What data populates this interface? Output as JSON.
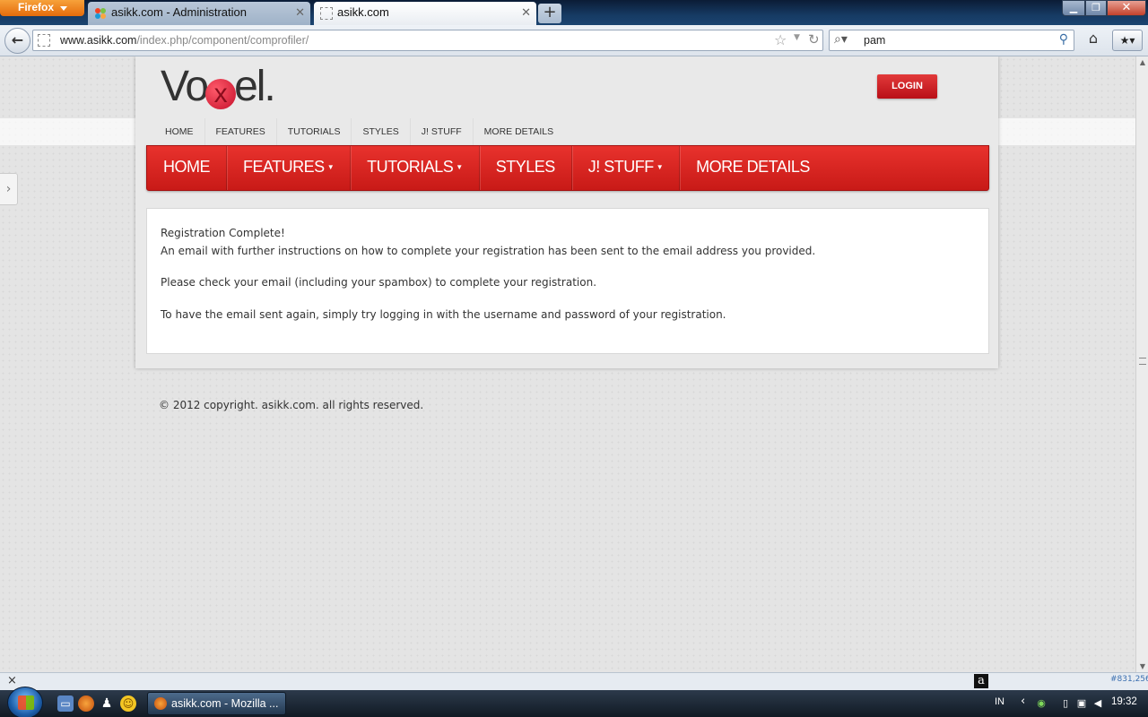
{
  "browser": {
    "menu_label": "Firefox",
    "tabs": [
      {
        "title": "asikk.com - Administration",
        "active": false
      },
      {
        "title": "asikk.com",
        "active": true
      }
    ],
    "new_tab_label": "+",
    "url": {
      "domain": "www.asikk.com",
      "path": "/index.php/component/comprofiler/"
    },
    "search_value": "pam",
    "icons": {
      "back": "back-arrow-icon",
      "star": "bookmark-star-icon",
      "reload": "reload-icon",
      "search": "magnifier-icon",
      "home": "home-icon",
      "bookmarks": "bookmarks-menu-icon"
    }
  },
  "site": {
    "logo_text": {
      "prefix": "Vo",
      "suffix": "el."
    },
    "logo_x": "x",
    "login_label": "LOGIN",
    "top_menu": [
      "HOME",
      "FEATURES",
      "TUTORIALS",
      "STYLES",
      "J! STUFF",
      "MORE DETAILS"
    ],
    "main_menu": [
      {
        "label": "HOME",
        "has_sub": false
      },
      {
        "label": "FEATURES",
        "has_sub": true
      },
      {
        "label": "TUTORIALS",
        "has_sub": true
      },
      {
        "label": "STYLES",
        "has_sub": false
      },
      {
        "label": "J! STUFF",
        "has_sub": true
      },
      {
        "label": "MORE DETAILS",
        "has_sub": false
      }
    ],
    "content": {
      "title": "Registration Complete!",
      "line1": "An email with further instructions on how to complete your registration has been sent to the email address you provided.",
      "line2": "Please check your email (including your spambox) to complete your registration.",
      "line3": "To have the email sent again, simply try logging in with the username and password of your registration."
    },
    "footer": "© 2012 copyright. asikk.com. all rights reserved.",
    "colors": {
      "accent_red": "#d82421",
      "login_red": "#c8151c"
    }
  },
  "statusbar": {
    "close_label": "×",
    "addon_letter": "a",
    "rank_text": "#831,256"
  },
  "taskbar": {
    "task_label": "asikk.com - Mozilla ...",
    "language": "IN",
    "clock": "19:32"
  }
}
